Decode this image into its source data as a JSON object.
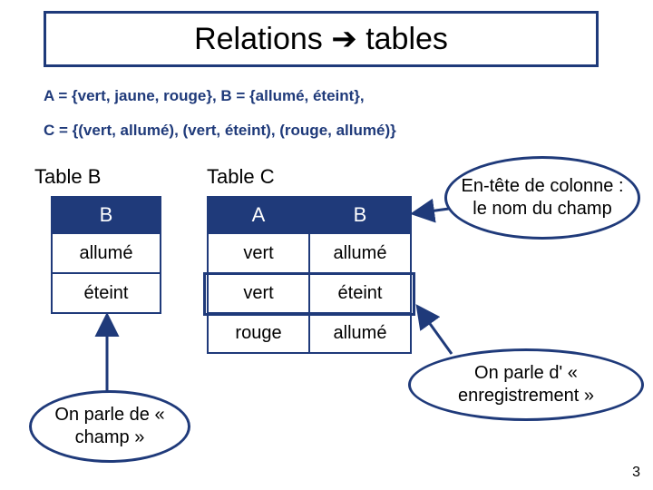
{
  "title": "Relations ➔ tables",
  "definitions": {
    "line1": "A = {vert, jaune, rouge}, B = {allumé, éteint},",
    "line2": "C = {(vert, allumé), (vert, éteint), (rouge, allumé)}"
  },
  "labels": {
    "tableB": "Table B",
    "tableC": "Table C"
  },
  "tableB": {
    "header": "B",
    "rows": [
      "allumé",
      "éteint"
    ]
  },
  "tableC": {
    "headers": [
      "A",
      "B"
    ],
    "rows": [
      [
        "vert",
        "allumé"
      ],
      [
        "vert",
        "éteint"
      ],
      [
        "rouge",
        "allumé"
      ]
    ]
  },
  "callouts": {
    "entete": "En-tête de colonne : le nom du champ",
    "champ": "On parle de « champ »",
    "enreg": "On parle d' « enregistrement »"
  },
  "page": "3"
}
